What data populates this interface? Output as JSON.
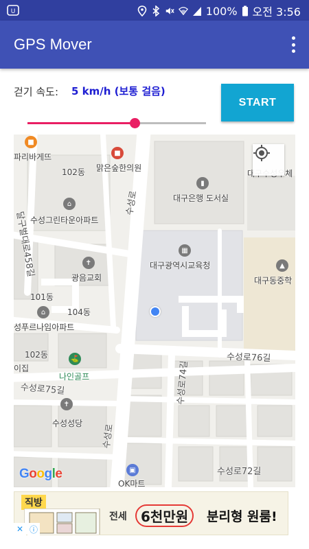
{
  "status_bar": {
    "battery_percent": "100%",
    "time": "오전 3:56",
    "icons": [
      "app-notification-icon",
      "location-icon",
      "bluetooth-icon",
      "mute-icon",
      "wifi-icon",
      "signal-icon",
      "battery-icon"
    ]
  },
  "app_bar": {
    "title": "GPS Mover",
    "menu_icon": "overflow-menu-icon"
  },
  "controls": {
    "speed_label": "걷기 속도:",
    "speed_value": "5 km/h (보통 걸음)",
    "start_label": "START",
    "slider_fraction": 0.6
  },
  "map": {
    "labels": {
      "paris": "파리바게뜨",
      "bldg102a": "102동",
      "clinic": "맑은숲한의원",
      "daegu_bank": "대구은행 도서실",
      "daegu_suseong": "대구수성우체",
      "suseong_green": "수성그린타운아파트",
      "daegu_beomeo": "달구벌대로458길",
      "suseongro_v": "수성로",
      "education": "대구광역시교육청",
      "gwangeum": "광음교회",
      "daegu_dongjung": "대구동중학",
      "bldg101": "101동",
      "bldg104": "104동",
      "purunae": "성푸르나임아파트",
      "bldg102b": "102동",
      "ijip": "이집",
      "naingolf": "나인골프",
      "suseong76": "수성로76길",
      "suseong74": "수성로74길",
      "suseong75": "수성로75길",
      "suseongdang": "수성성당",
      "suseongro_v2": "수성로",
      "ok_mart": "OK마트",
      "suseong72": "수성로72길"
    },
    "logo_letters": [
      "G",
      "o",
      "o",
      "g",
      "l",
      "e"
    ],
    "my_location_icon": "my-location-icon"
  },
  "ad": {
    "brand": "직방",
    "prefix": "전세",
    "highlight": "6천만원",
    "rest": "분리형 원룸!",
    "close_icon": "close-icon",
    "info_icon": "info-icon"
  },
  "colors": {
    "status_bar": "#303f9f",
    "app_bar": "#3f51b5",
    "accent": "#e91e63",
    "start_button": "#12a5d2",
    "speed_value": "#1e1ed2",
    "location_dot": "#4285f4"
  }
}
